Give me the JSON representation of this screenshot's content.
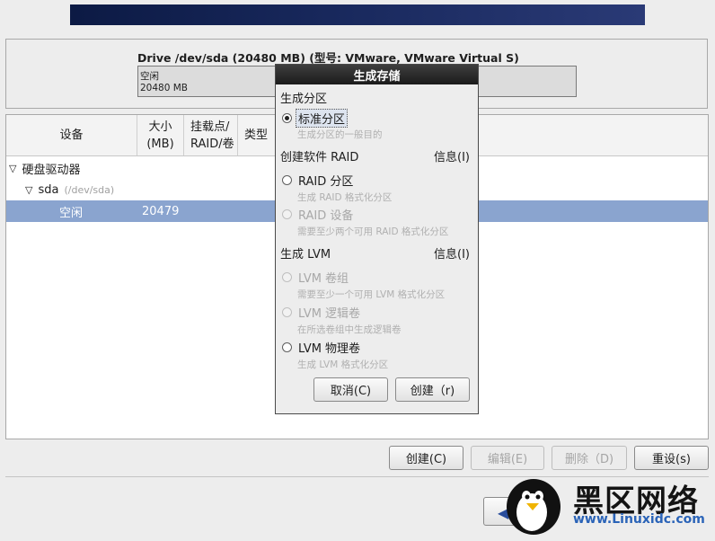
{
  "drive": {
    "title": "Drive /dev/sda (20480 MB) (型号: VMware, VMware Virtual S)",
    "bar_label": "空闲",
    "bar_size": "20480 MB"
  },
  "table": {
    "headers": {
      "device": "设备",
      "size": "大小\n(MB)",
      "mount": "挂载点/\nRAID/卷",
      "type": "类型"
    },
    "rows": {
      "group": "硬盘驱动器",
      "disk_name": "sda",
      "disk_path": "(/dev/sda)",
      "free_label": "空闲",
      "free_size": "20479"
    }
  },
  "buttons": {
    "create": "创建(C)",
    "edit": "编辑(E)",
    "delete": "删除（D)",
    "reset": "重设(s)"
  },
  "dialog": {
    "title": "生成存储",
    "section_partition": "生成分区",
    "opt_standard": "标准分区",
    "desc_standard": "生成分区的一般目的",
    "section_raid": "创建软件 RAID",
    "info_raid": "信息(I)",
    "opt_raid_partition": "RAID 分区",
    "desc_raid_partition": "生成 RAID 格式化分区",
    "opt_raid_device": "RAID 设备",
    "desc_raid_device": "需要至少两个可用 RAID 格式化分区",
    "section_lvm": "生成 LVM",
    "info_lvm": "信息(I)",
    "opt_lvm_vg": "LVM 卷组",
    "desc_lvm_vg": "需要至少一个可用 LVM 格式化分区",
    "opt_lvm_lv": "LVM 逻辑卷",
    "desc_lvm_lv": "在所选卷组中生成逻辑卷",
    "opt_lvm_pv": "LVM 物理卷",
    "desc_lvm_pv": "生成 LVM 格式化分区",
    "cancel": "取消(C)",
    "create": "创建（r)"
  },
  "watermark": {
    "text": "黑区网络",
    "url": "www.Linuxidc.com"
  },
  "icons": {
    "expand": "triangle-down-icon",
    "back": "back-arrow-icon"
  }
}
